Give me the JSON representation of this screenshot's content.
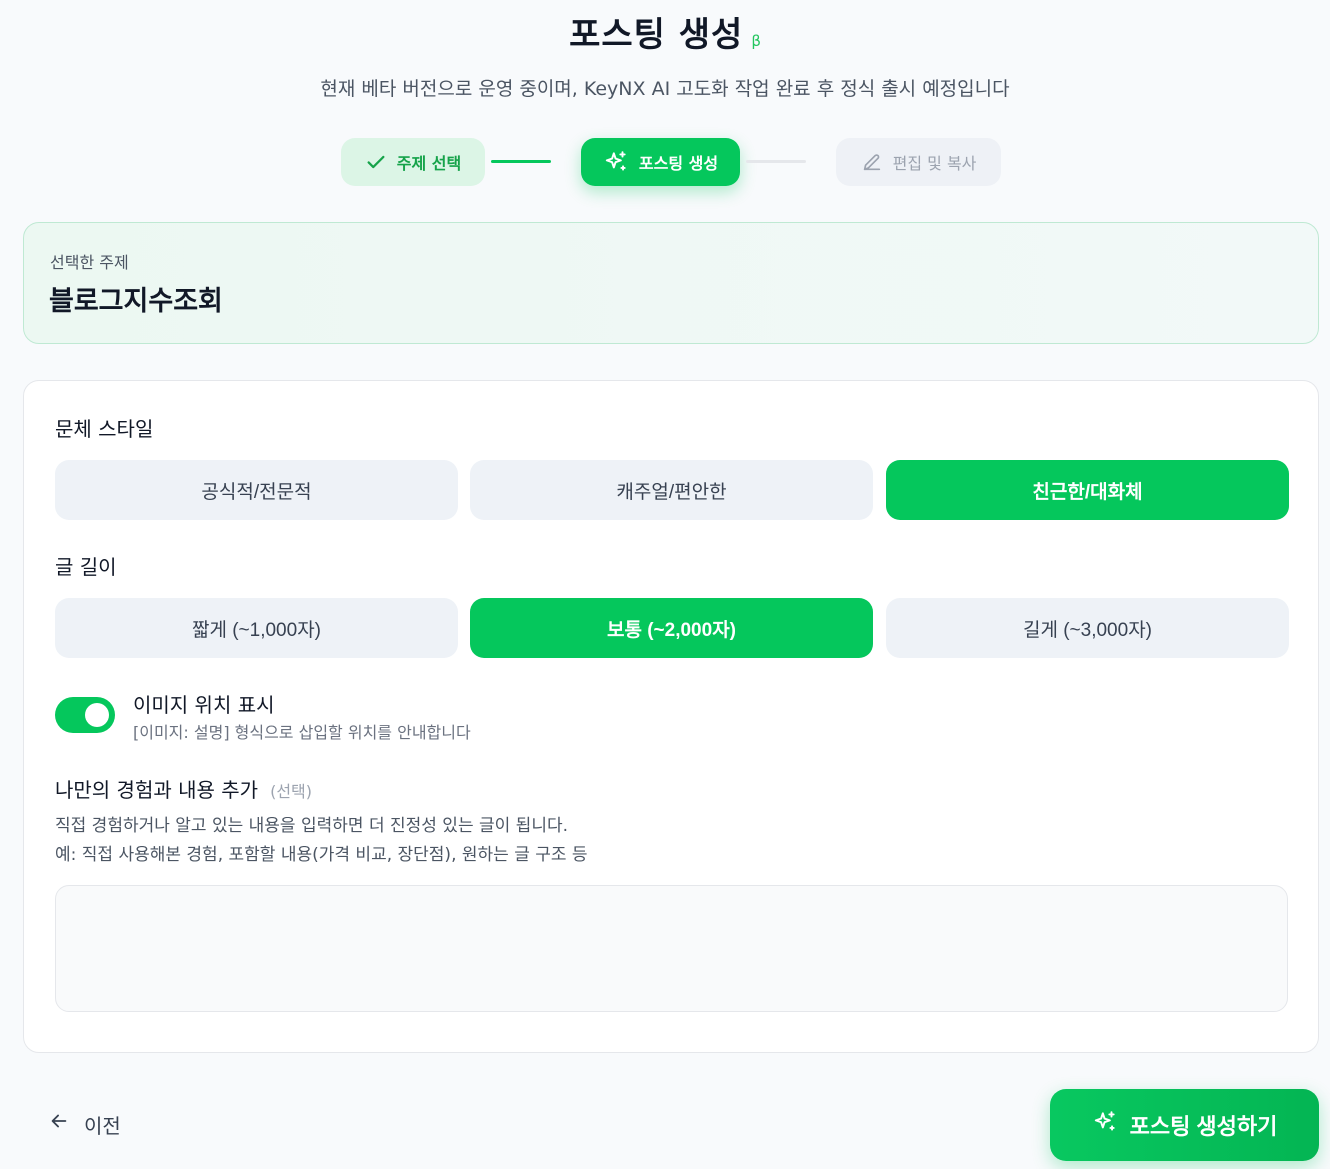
{
  "header": {
    "title": "포스팅 생성",
    "beta_badge": "β",
    "subtitle": "현재 베타 버전으로 운영 중이며, KeyNX AI 고도화 작업 완료 후 정식 출시 예정입니다"
  },
  "stepper": {
    "steps": [
      {
        "label": "주제 선택",
        "icon": "check-icon",
        "state": "done"
      },
      {
        "label": "포스팅 생성",
        "icon": "sparkles-icon",
        "state": "active"
      },
      {
        "label": "편집 및 복사",
        "icon": "pencil-icon",
        "state": "pending"
      }
    ]
  },
  "topic": {
    "label": "선택한 주제",
    "value": "블로그지수조회"
  },
  "style": {
    "label": "문체 스타일",
    "options": [
      "공식적/전문적",
      "캐주얼/편안한",
      "친근한/대화체"
    ],
    "selected": "친근한/대화체"
  },
  "length": {
    "label": "글 길이",
    "options": [
      "짧게 (~1,000자)",
      "보통 (~2,000자)",
      "길게 (~3,000자)"
    ],
    "selected": "보통 (~2,000자)"
  },
  "image_toggle": {
    "title": "이미지 위치 표시",
    "description": "[이미지: 설명] 형식으로 삽입할 위치를 안내합니다",
    "enabled": true
  },
  "experience": {
    "title": "나만의 경험과 내용 추가",
    "optional_tag": "(선택)",
    "description_line1": "직접 경험하거나 알고 있는 내용을 입력하면 더 진정성 있는 글이 됩니다.",
    "description_line2": "예: 직접 사용해본 경험, 포함할 내용(가격 비교, 장단점), 원하는 글 구조 등",
    "value": ""
  },
  "footer": {
    "prev_label": "이전",
    "generate_label": "포스팅 생성하기"
  },
  "colors": {
    "accent": "#05c75c",
    "accent_light": "#dcf5e6",
    "neutral_button": "#eef2f7"
  }
}
